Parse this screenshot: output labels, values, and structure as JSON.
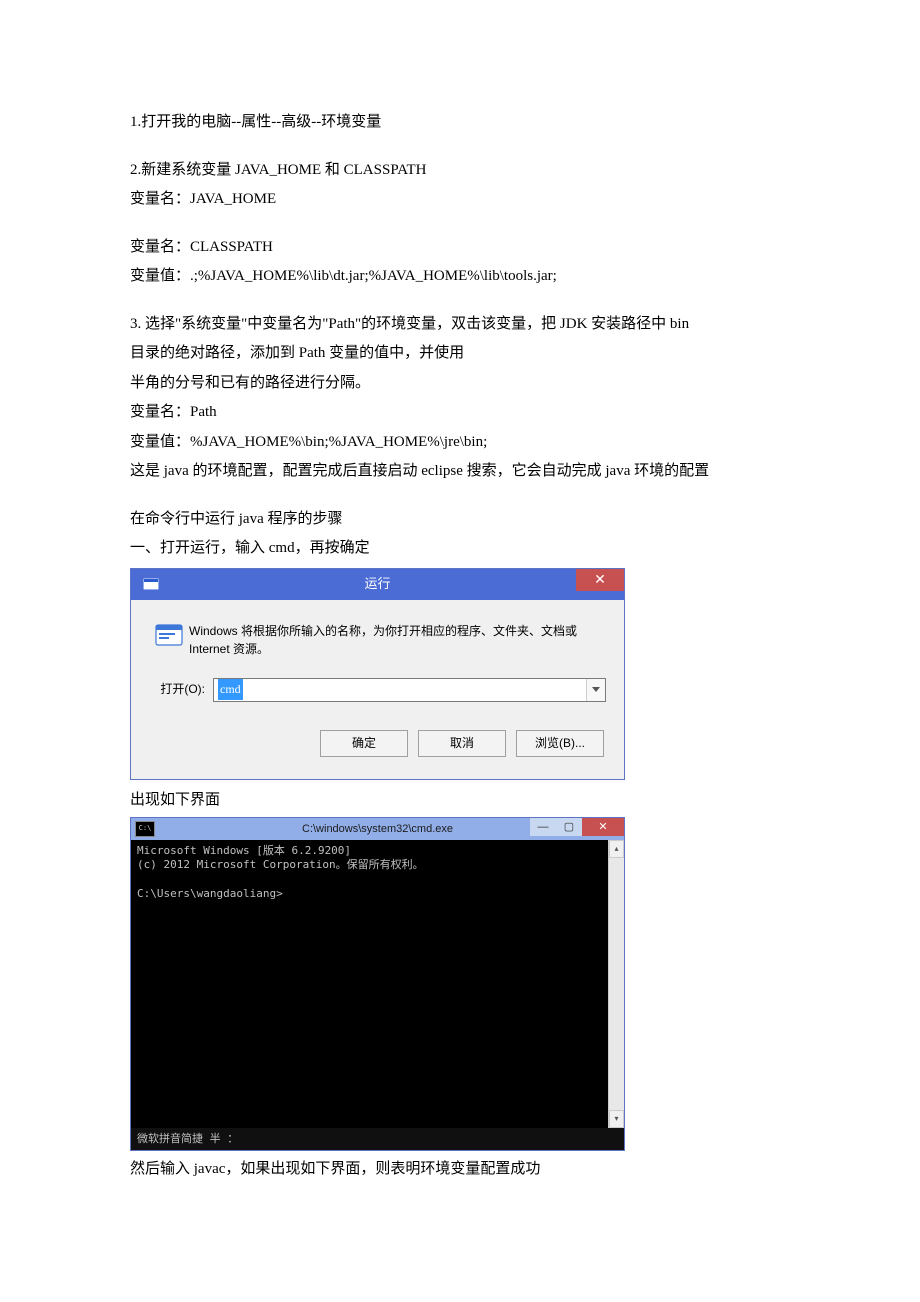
{
  "doc": {
    "step1": "1.打开我的电脑--属性--高级--环境变量",
    "step2_title": "2.新建系统变量 JAVA_HOME 和 CLASSPATH",
    "step2_varname1": "变量名：JAVA_HOME",
    "step2_varname2": "变量名：CLASSPATH",
    "step2_varvalue2": "变量值：.;%JAVA_HOME%\\lib\\dt.jar;%JAVA_HOME%\\lib\\tools.jar;",
    "step3_line1": "3. 选择\"系统变量\"中变量名为\"Path\"的环境变量，双击该变量，把 JDK 安装路径中 bin",
    "step3_line2": "目录的绝对路径，添加到 Path 变量的值中，并使用",
    "step3_line3": "半角的分号和已有的路径进行分隔。",
    "step3_varname": "变量名：Path",
    "step3_varvalue": "变量值：%JAVA_HOME%\\bin;%JAVA_HOME%\\jre\\bin;",
    "step3_note": "这是 java 的环境配置，配置完成后直接启动 eclipse 搜索，它会自动完成 java 环境的配置",
    "cmd_steps_title": "在命令行中运行 java 程序的步骤",
    "cmd_step1": "一、打开运行，输入 cmd，再按确定",
    "appear_text": "出现如下界面",
    "then_text": "然后输入 javac，如果出现如下界面，则表明环境变量配置成功"
  },
  "run_dialog": {
    "title": "运行",
    "desc": "Windows 将根据你所输入的名称，为你打开相应的程序、文件夹、文档或 Internet 资源。",
    "open_label": "打开(O):",
    "value": "cmd",
    "btn_ok": "确定",
    "btn_cancel": "取消",
    "btn_browse": "浏览(B)..."
  },
  "cmd_window": {
    "title": "C:\\windows\\system32\\cmd.exe",
    "line1": "Microsoft Windows [版本 6.2.9200]",
    "line2": "(c) 2012 Microsoft Corporation。保留所有权利。",
    "prompt": "C:\\Users\\wangdaoliang>",
    "ime_status": "微软拼音简捷 半 ："
  }
}
